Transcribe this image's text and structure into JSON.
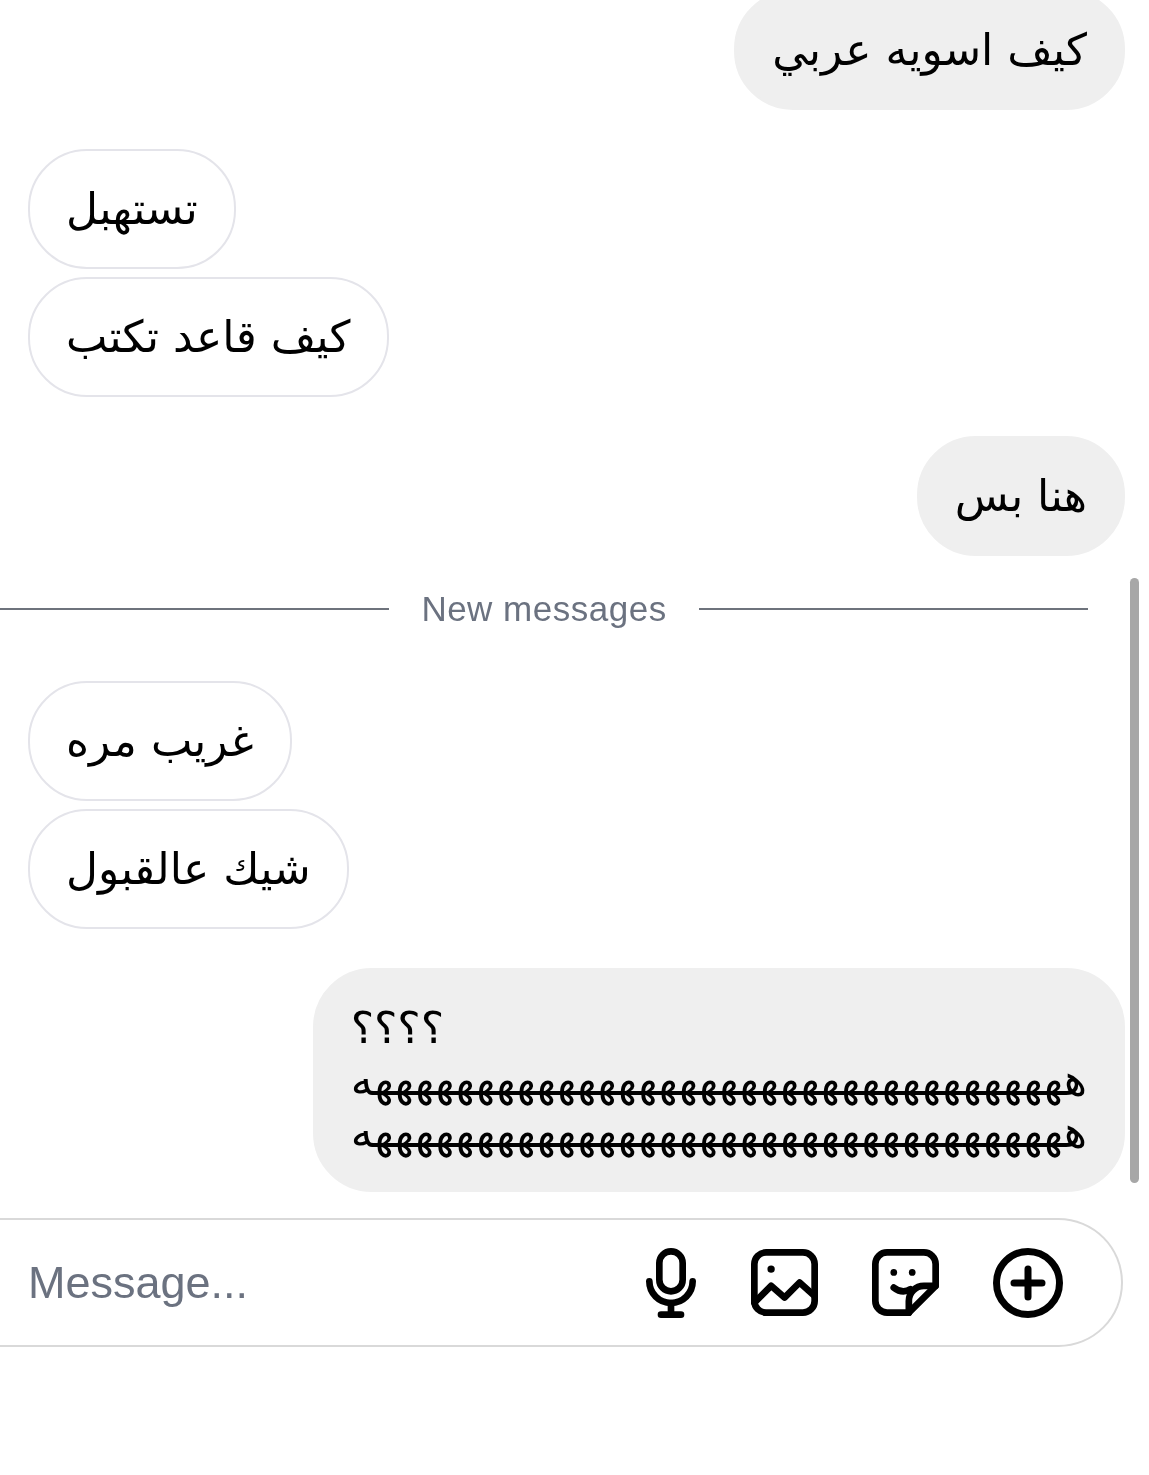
{
  "conversation": [
    {
      "kind": "sent",
      "messages": [
        "كيف اسويه عربي"
      ]
    },
    {
      "kind": "received",
      "messages": [
        "تستهبل",
        "كيف قاعد تكتب"
      ]
    },
    {
      "kind": "sent",
      "messages": [
        "هنا بس"
      ]
    },
    {
      "kind": "divider",
      "label": "New messages"
    },
    {
      "kind": "received",
      "messages": [
        "غريب مره",
        "شيك عالقبول"
      ]
    },
    {
      "kind": "sent",
      "messages": [
        "؟؟؟؟\nهههههههههههههههههههههههههههههههههههه\nهههههههههههههههههههههههههههههههههههه"
      ]
    }
  ],
  "composer": {
    "placeholder": "Message..."
  }
}
